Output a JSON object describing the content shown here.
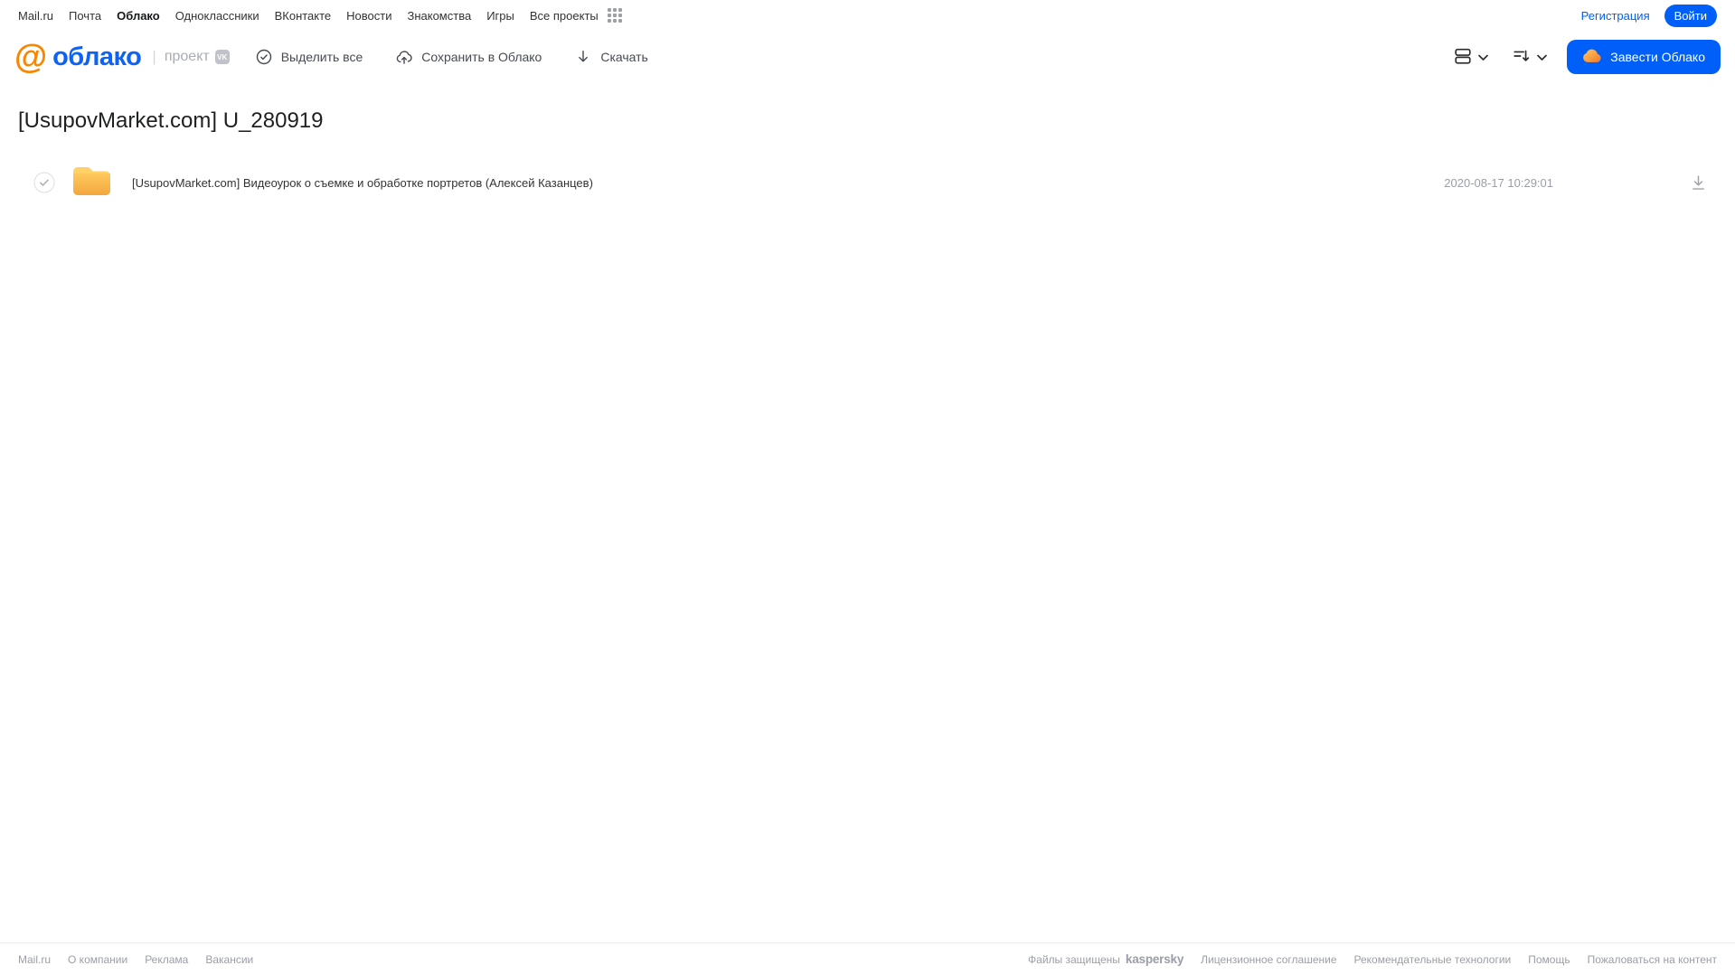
{
  "topbar": {
    "links": [
      "Mail.ru",
      "Почта",
      "Облако",
      "Одноклассники",
      "ВКонтакте",
      "Новости",
      "Знакомства",
      "Игры",
      "Все проекты"
    ],
    "active_link": "Облако",
    "registration_label": "Регистрация",
    "login_label": "Войти"
  },
  "header": {
    "logo": {
      "at_symbol": "@",
      "brand": "облако",
      "project_label": "проект",
      "vk_badge": "VK"
    },
    "toolbar": {
      "select_all_label": "Выделить все",
      "save_to_cloud_label": "Сохранить в Облако",
      "download_label": "Скачать"
    },
    "cta_label": "Завести Облако"
  },
  "page": {
    "title": "[UsupovMarket.com] U_280919"
  },
  "files": [
    {
      "type": "folder",
      "name": "[UsupovMarket.com] Видеоурок о съемке и обработке портретов (Алексей Казанцев)",
      "modified": "2020-08-17 10:29:01"
    }
  ],
  "footer": {
    "left_links": [
      "Mail.ru",
      "О компании",
      "Реклама",
      "Вакансии"
    ],
    "protected_prefix": "Файлы защищены",
    "kaspersky_label": "kaspersky",
    "right_links": [
      "Лицензионное соглашение",
      "Рекомендательные технологии",
      "Помощь",
      "Пожаловаться на контент"
    ]
  },
  "icons": [
    "apps-grid-icon",
    "mailru-at-icon",
    "vk-badge-icon",
    "check-circle-icon",
    "cloud-upload-icon",
    "download-icon",
    "list-view-icon",
    "chevron-down-icon",
    "sort-icon",
    "cloud-icon",
    "row-checkbox-icon",
    "folder-icon",
    "file-download-icon"
  ],
  "colors": {
    "accent_blue": "#005ff9",
    "logo_orange": "#f88600",
    "folder_yellow_top": "#ffd166",
    "folder_yellow_bottom": "#f2a73e",
    "kaspersky_green": "#009a82",
    "gray_text": "#9b9ea6",
    "toolbar_text": "#464a52"
  }
}
